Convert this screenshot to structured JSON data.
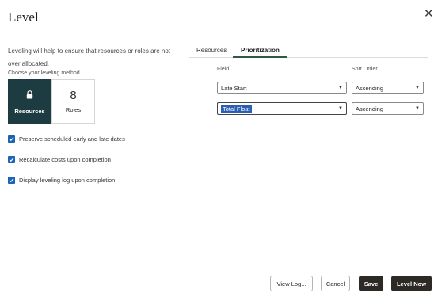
{
  "dialog": {
    "title": "Level",
    "close_icon": "close-icon"
  },
  "left": {
    "description": "Leveling will help to ensure that resources or roles are not over allocated.",
    "method_label": "Choose your leveling method",
    "methods": [
      {
        "label": "Resources",
        "icon": "lock-icon",
        "selected": true
      },
      {
        "label": "Roles",
        "icon": "figure-eight-icon",
        "glyph": "8",
        "selected": false
      }
    ],
    "options": [
      {
        "label": "Preserve scheduled early and late dates",
        "checked": true
      },
      {
        "label": "Recalculate costs upon completion",
        "checked": true
      },
      {
        "label": "Display leveling log upon completion",
        "checked": true
      }
    ]
  },
  "tabs": [
    {
      "label": "Resources",
      "active": false
    },
    {
      "label": "Prioritization",
      "active": true
    }
  ],
  "prioritization": {
    "field_header": "Field",
    "sort_header": "Sort Order",
    "rows": [
      {
        "field": "Late Start",
        "sort": "Ascending"
      },
      {
        "field": "Total Float",
        "sort": "Ascending"
      }
    ]
  },
  "footer": {
    "view_log": "View Log...",
    "cancel": "Cancel",
    "save": "Save",
    "level_now": "Level Now"
  },
  "colors": {
    "selected_method_bg": "#1c3c41",
    "checkbox": "#1a64b8",
    "tab_underline": "#305a40",
    "primary_button": "#2d2a26"
  }
}
